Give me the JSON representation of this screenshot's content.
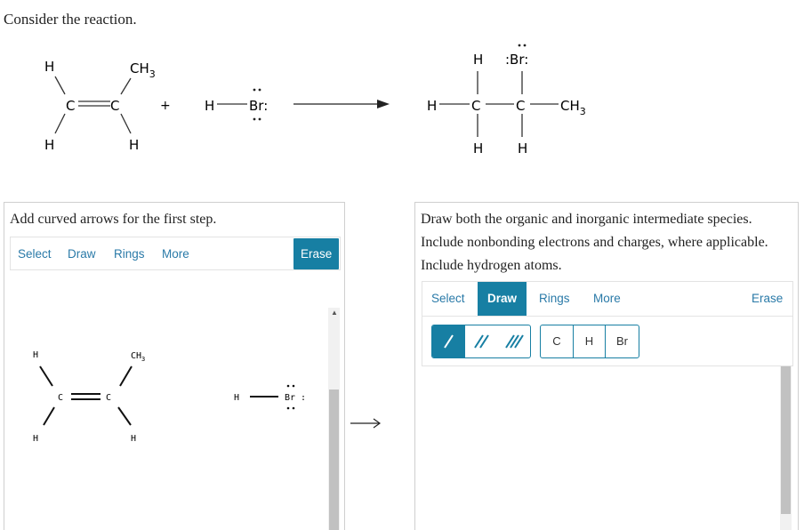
{
  "question": "Consider the reaction.",
  "reaction": {
    "reactant1": {
      "h_top_left": "H",
      "ch3": "CH",
      "ch3_sub": "3",
      "c1": "C",
      "c2": "C",
      "h_bottom_left": "H",
      "h_bottom_right": "H"
    },
    "plus": "+",
    "reactant2": {
      "h": "H",
      "br": "Br:"
    },
    "product": {
      "h_top": "H",
      "br": ":Br:",
      "h_left": "H",
      "c1": "C",
      "c2": "C",
      "ch3": "CH",
      "ch3_sub": "3",
      "h_bottom_left": "H",
      "h_bottom_right": "H"
    }
  },
  "left_panel": {
    "prompt": "Add curved arrows for the first step.",
    "toolbar": {
      "select": "Select",
      "draw": "Draw",
      "rings": "Rings",
      "more": "More",
      "erase": "Erase"
    },
    "canvas": {
      "h_top": "H",
      "ch3": "CH",
      "ch3_sub": "3",
      "c1": "C",
      "c2": "C",
      "h_bottom_left": "H",
      "h_bottom_right": "H",
      "h_reagent": "H",
      "br_reagent": "Br :"
    }
  },
  "between_arrow": "⟶",
  "right_panel": {
    "prompt": "Draw both the organic and inorganic intermediate species. Include nonbonding electrons and charges, where applicable. Include hydrogen atoms.",
    "toolbar": {
      "select": "Select",
      "draw": "Draw",
      "rings": "Rings",
      "more": "More",
      "erase": "Erase"
    },
    "atoms": [
      "C",
      "H",
      "Br"
    ],
    "bonds": [
      "single-bond-icon",
      "double-bond-icon",
      "triple-bond-icon"
    ]
  },
  "colors": {
    "accent": "#177fa3",
    "link": "#2a7aa8",
    "border": "#cfcfcf"
  }
}
